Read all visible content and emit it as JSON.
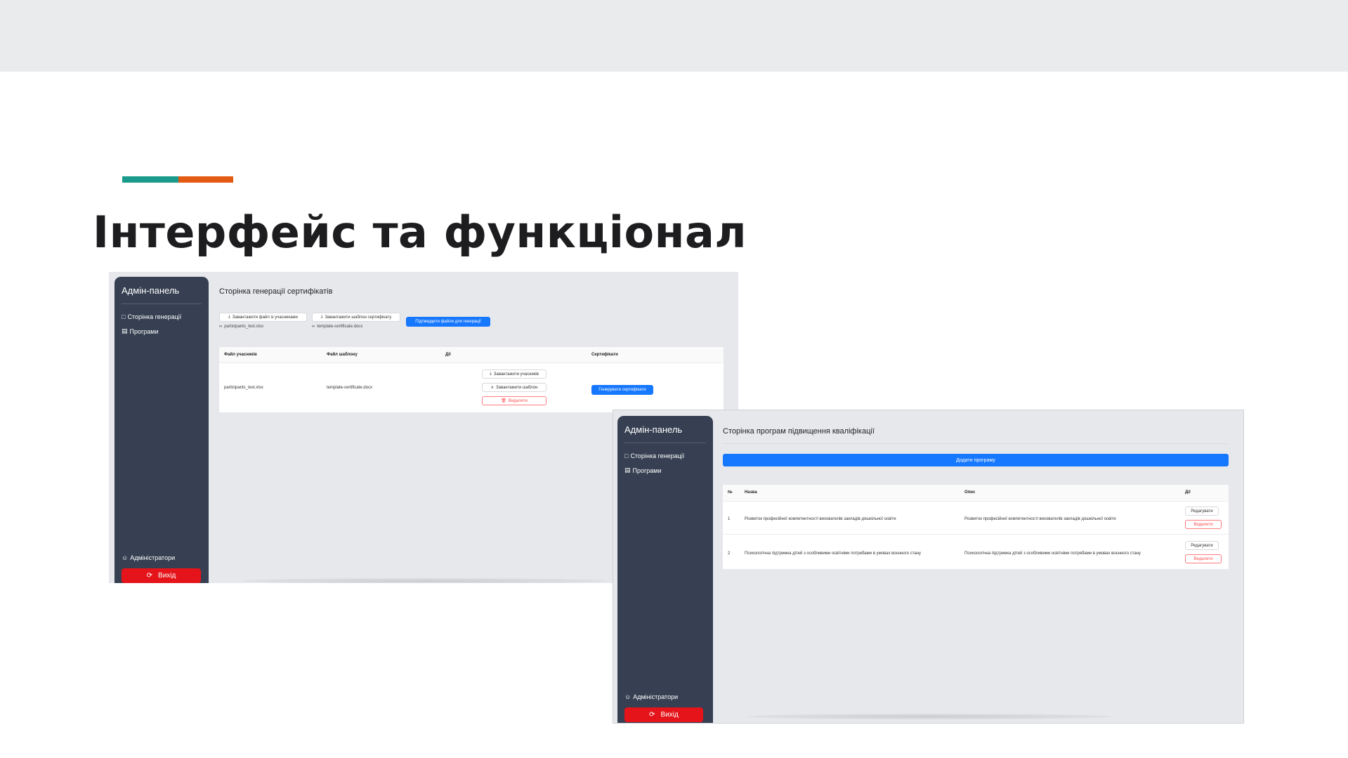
{
  "slide": {
    "title": "Інтерфейс та функціонал"
  },
  "colors": {
    "accent_teal": "#1a9a8a",
    "accent_orange": "#e35a12",
    "sidebar": "#364052",
    "primary": "#1677ff",
    "danger": "#e4141a"
  },
  "sidebar": {
    "title": "Адмін-панель",
    "items": [
      {
        "icon": "file-icon",
        "label": "Сторінка генерації"
      },
      {
        "icon": "book-icon",
        "label": "Програми"
      }
    ],
    "admins": {
      "icon": "user-icon",
      "label": "Адміністратори"
    },
    "exit": {
      "icon": "logout-icon",
      "label": "Вихід"
    }
  },
  "generation_page": {
    "title": "Сторінка генерації сертифікатів",
    "upload_participants": "Завантажити файл із учасниками",
    "upload_template": "Завантажити шаблон сертифікату",
    "confirm_button": "Підтвердити файли для генерації",
    "participants_file": "participants_test.xlsx",
    "template_file": "template-certificate.docx",
    "table": {
      "headers": [
        "Файл учасників",
        "Файл шаблону",
        "Дії",
        "Сертифікати"
      ],
      "rows": [
        {
          "participants": "participants_test.xlsx",
          "template": "template-certificate.docx",
          "download_participants": "Завантажити учасників",
          "download_template": "Завантажити шаблон",
          "delete": "Видалити",
          "generate": "Генерувати сертифікати"
        }
      ]
    }
  },
  "programs_page": {
    "title": "Сторінка програм підвищення кваліфікації",
    "add_button": "Додати програму",
    "table": {
      "headers": [
        "№",
        "Назва",
        "Опис",
        "Дії"
      ],
      "rows": [
        {
          "num": "1",
          "name": "Розвиток професійної компетентності вихователів закладів дошкільної освіти",
          "description": "Розвиток професійної компетентності вихователів закладів дошкільної освіти",
          "edit": "Редагувати",
          "delete": "Видалити"
        },
        {
          "num": "2",
          "name": "Психологічна підтримка дітей з особливими освітніми потребами в умовах воєнного стану",
          "description": "Психологічна підтримка дітей з особливими освітніми потребами в умовах воєнного стану",
          "edit": "Редагувати",
          "delete": "Видалити"
        }
      ]
    }
  }
}
